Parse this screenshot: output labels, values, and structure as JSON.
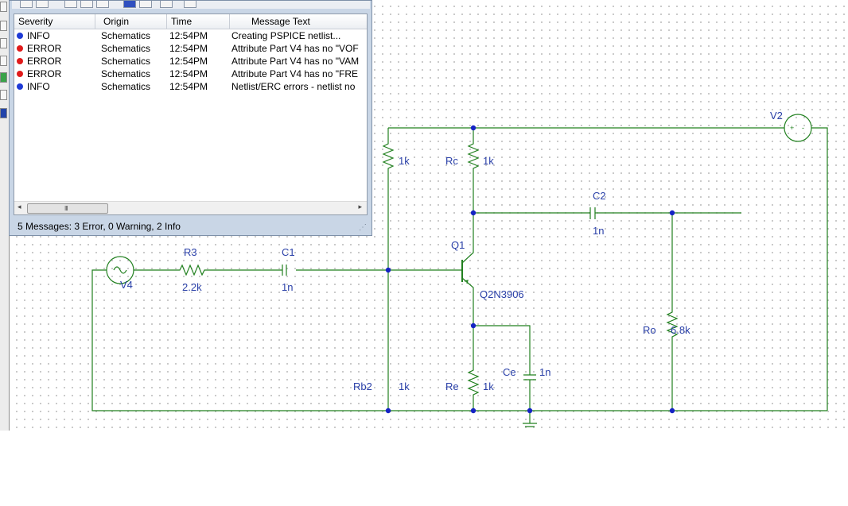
{
  "message_window": {
    "columns": [
      "Severity",
      "Origin",
      "Time",
      "Message Text"
    ],
    "rows": [
      {
        "severity": "INFO",
        "origin": "Schematics",
        "time": "12:54PM",
        "message": "Creating PSPICE netlist...",
        "color": "#1f3bd6"
      },
      {
        "severity": "ERROR",
        "origin": "Schematics",
        "time": "12:54PM",
        "message": "Attribute Part V4 has no \"VOF",
        "color": "#e01b1b"
      },
      {
        "severity": "ERROR",
        "origin": "Schematics",
        "time": "12:54PM",
        "message": "Attribute Part V4 has no \"VAM",
        "color": "#e01b1b"
      },
      {
        "severity": "ERROR",
        "origin": "Schematics",
        "time": "12:54PM",
        "message": "Attribute Part V4 has no \"FRE",
        "color": "#e01b1b"
      },
      {
        "severity": "INFO",
        "origin": "Schematics",
        "time": "12:54PM",
        "message": "Netlist/ERC errors - netlist no",
        "color": "#1f3bd6"
      }
    ],
    "status": "5 Messages:  3 Error, 0 Warning, 2 Info",
    "scroll_grip": "III",
    "scroll_left": "◂",
    "scroll_right": "▸",
    "resize_grip": "⋰"
  },
  "schematic": {
    "wire_color": "#21801f",
    "label_color": "#2a40a8",
    "node_color": "#1523c4",
    "labels": {
      "v2": "V2",
      "rb1_value": "1k",
      "rc_name": "Rc",
      "rc_value": "1k",
      "c2_name": "C2",
      "c2_value": "1n",
      "q1_name": "Q1",
      "q1_model": "Q2N3906",
      "r3_name": "R3",
      "r3_value": "2.2k",
      "c1_name": "C1",
      "c1_value": "1n",
      "v4": "V4",
      "ro_name": "Ro",
      "ro_value": "6.8k",
      "ce_name": "Ce",
      "ce_value": "1n",
      "rb2_name": "Rb2",
      "rb2_value": "1k",
      "re_name": "Re",
      "re_value": "1k"
    }
  }
}
